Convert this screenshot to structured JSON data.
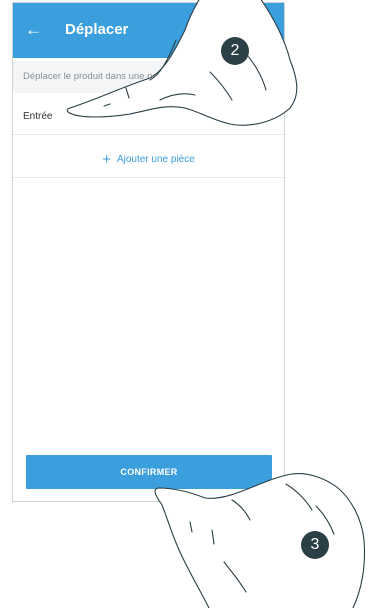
{
  "header": {
    "title": "Déplacer",
    "back_icon": "arrow-left-icon"
  },
  "subtitle": "Déplacer le produit dans une nouvelle pièce",
  "rooms": [
    {
      "label": "Entrée"
    }
  ],
  "add_room": {
    "icon": "plus-icon",
    "label": "Ajouter une pièce"
  },
  "confirm_label": "CONFIRMER",
  "steps": [
    "2",
    "3"
  ],
  "colors": {
    "accent": "#3a9fdc",
    "badge": "#2b3f47"
  }
}
